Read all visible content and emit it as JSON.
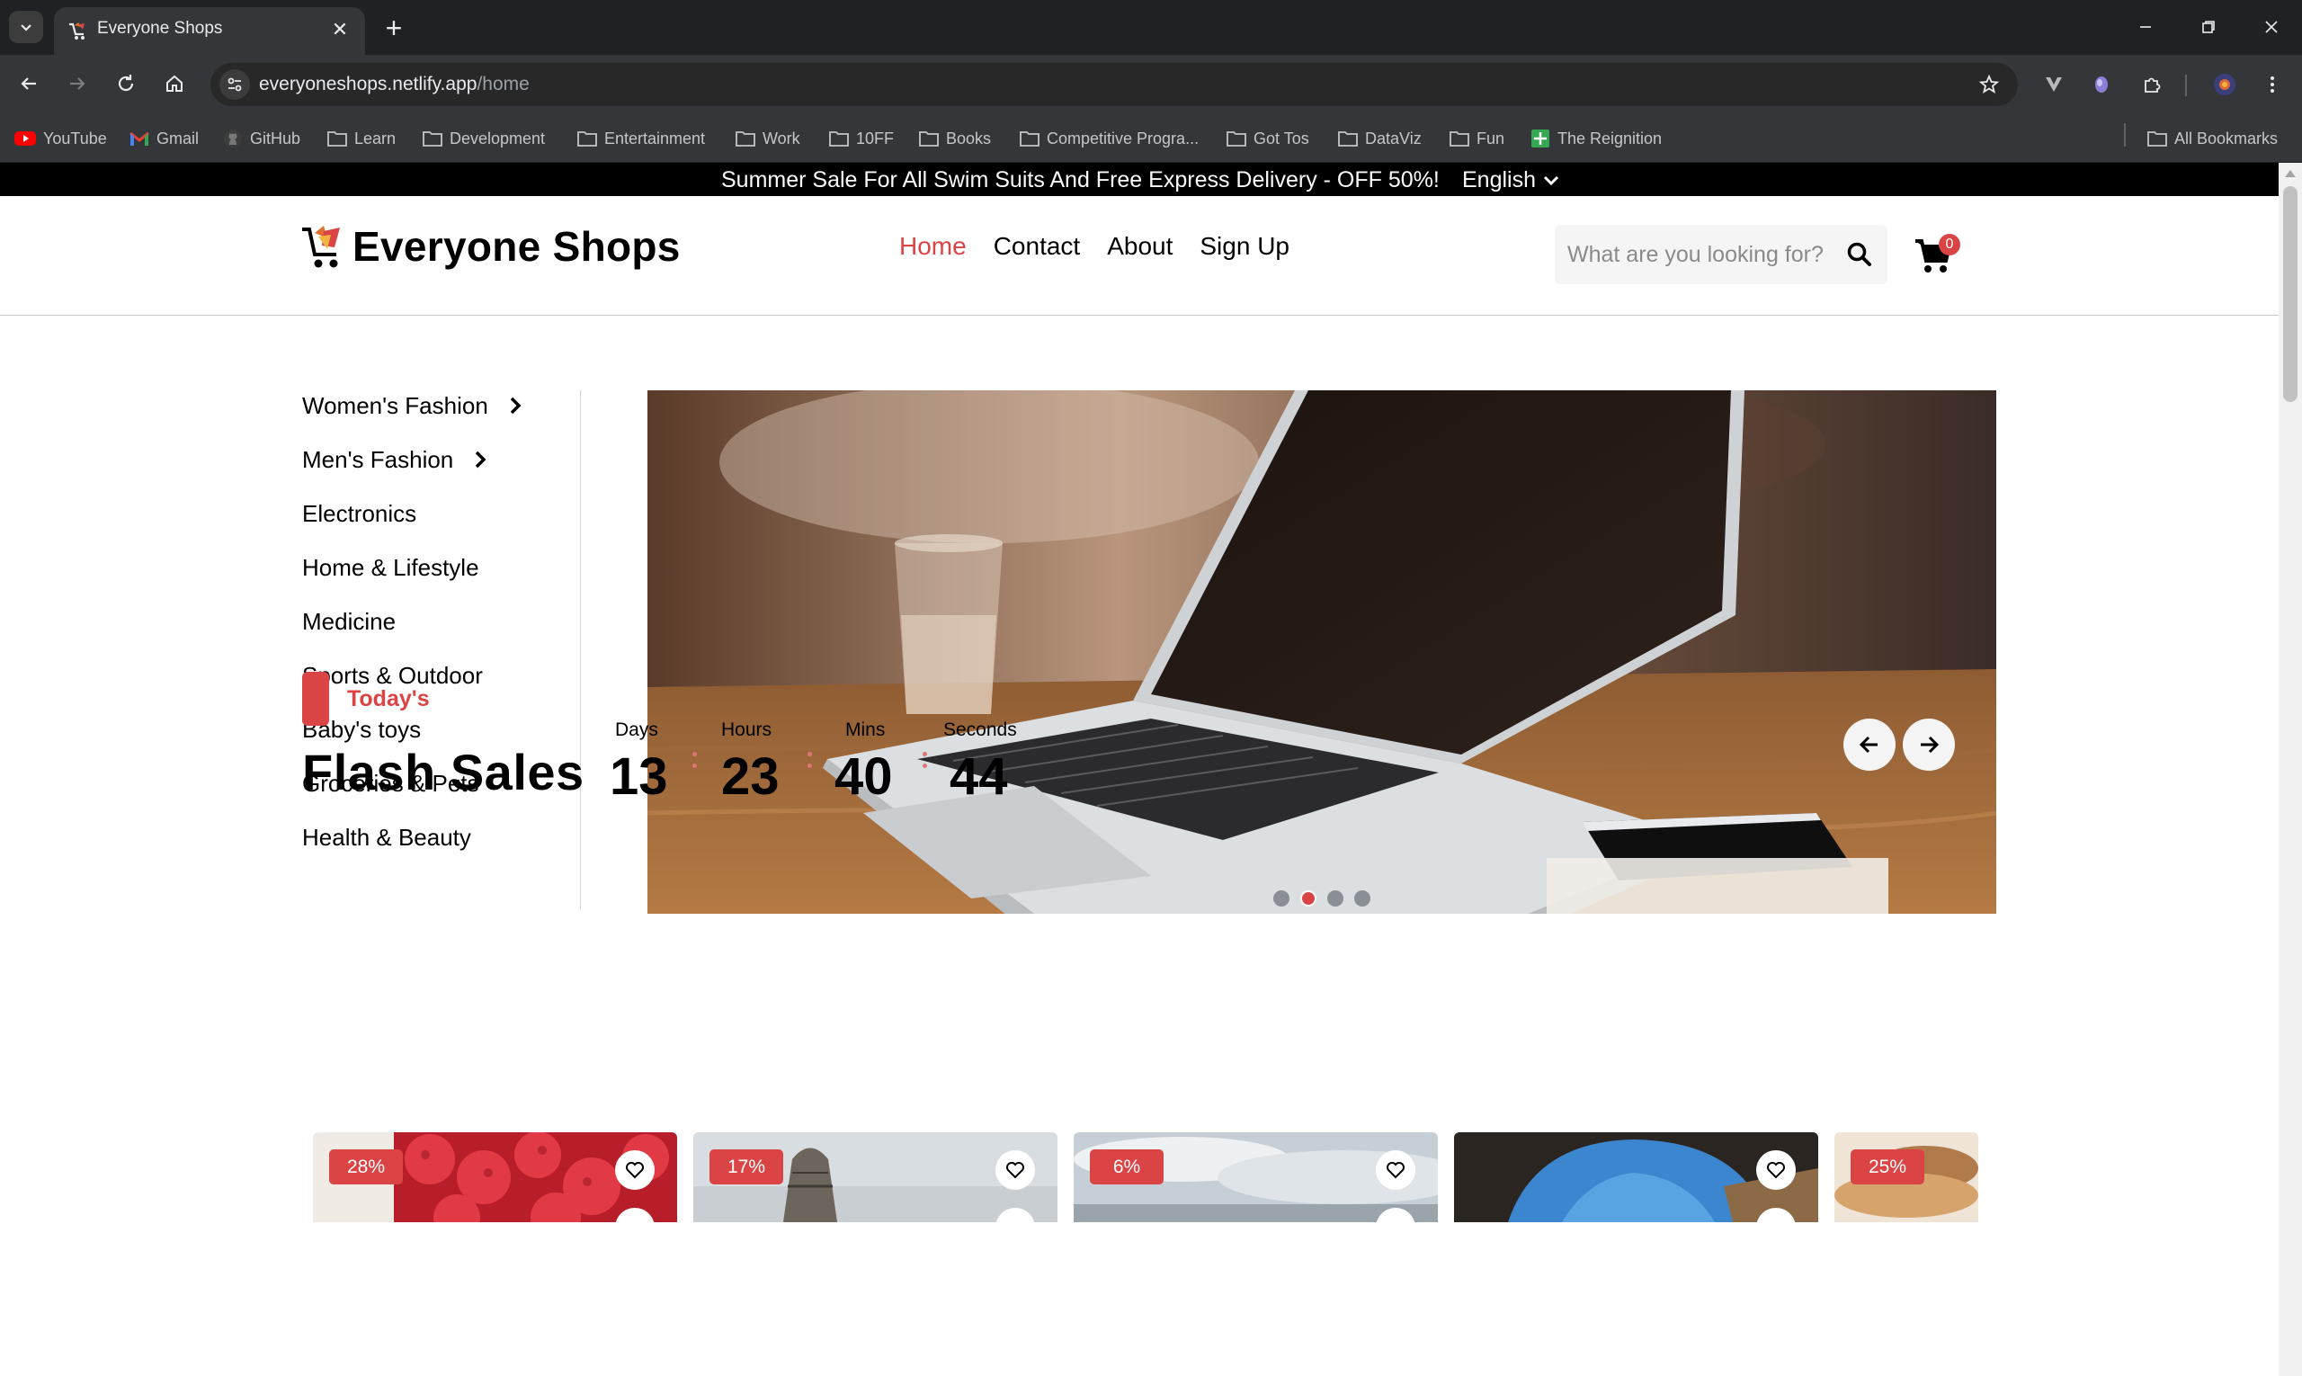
{
  "browser": {
    "tab_title": "Everyone Shops",
    "url_host": "everyoneshops.netlify.app",
    "url_path": "/home",
    "bookmarks": [
      {
        "label": "YouTube",
        "icon": "youtube-icon"
      },
      {
        "label": "Gmail",
        "icon": "gmail-icon"
      },
      {
        "label": "GitHub",
        "icon": "github-icon"
      },
      {
        "label": "Learn",
        "icon": "folder-icon"
      },
      {
        "label": "Development",
        "icon": "folder-icon"
      },
      {
        "label": "Entertainment",
        "icon": "folder-icon"
      },
      {
        "label": "Work",
        "icon": "folder-icon"
      },
      {
        "label": "10FF",
        "icon": "folder-icon"
      },
      {
        "label": "Books",
        "icon": "folder-icon"
      },
      {
        "label": "Competitive Progra...",
        "icon": "folder-icon"
      },
      {
        "label": "Got Tos",
        "icon": "folder-icon"
      },
      {
        "label": "DataViz",
        "icon": "folder-icon"
      },
      {
        "label": "Fun",
        "icon": "folder-icon"
      },
      {
        "label": "The Reignition",
        "icon": "sheets-icon"
      }
    ],
    "all_bookmarks": "All Bookmarks"
  },
  "announcement": {
    "text": "Summer Sale For All Swim Suits And Free Express Delivery - OFF 50%!",
    "language": "English"
  },
  "header": {
    "logo": "Everyone Shops",
    "nav": [
      "Home",
      "Contact",
      "About",
      "Sign Up"
    ],
    "active_nav": "Home",
    "search_placeholder": "What are you looking for?",
    "cart_count": "0"
  },
  "categories": [
    {
      "label": "Women's Fashion",
      "has_submenu": true
    },
    {
      "label": "Men's Fashion",
      "has_submenu": true
    },
    {
      "label": "Electronics",
      "has_submenu": false
    },
    {
      "label": "Home & Lifestyle",
      "has_submenu": false
    },
    {
      "label": "Medicine",
      "has_submenu": false
    },
    {
      "label": "Sports & Outdoor",
      "has_submenu": false
    },
    {
      "label": "Baby's toys",
      "has_submenu": false
    },
    {
      "label": "Groceries & Pets",
      "has_submenu": false
    },
    {
      "label": "Health & Beauty",
      "has_submenu": false
    }
  ],
  "hero": {
    "slide_count": 4,
    "active_slide": 2,
    "image": "laptop-on-wooden-table"
  },
  "flash_sales": {
    "section_label": "Today's",
    "title": "Flash Sales",
    "countdown": [
      {
        "label": "Days",
        "value": "13"
      },
      {
        "label": "Hours",
        "value": "23"
      },
      {
        "label": "Mins",
        "value": "40"
      },
      {
        "label": "Seconds",
        "value": "44"
      }
    ],
    "products": [
      {
        "discount": "28%",
        "image": "raspberries"
      },
      {
        "discount": "17%",
        "image": "building"
      },
      {
        "discount": "6%",
        "image": "sky"
      },
      {
        "discount": "",
        "image": "cave-arch"
      },
      {
        "discount": "25%",
        "image": "food"
      }
    ]
  },
  "colors": {
    "accent": "#db4444",
    "announcement_bg": "#000000",
    "chrome_bg": "#202124"
  }
}
